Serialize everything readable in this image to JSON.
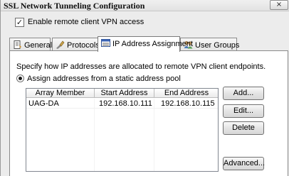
{
  "window": {
    "title": "SSL Network Tunneling Configuration",
    "close_glyph": "×"
  },
  "enable_vpn": {
    "label": "Enable remote client VPN access",
    "checked": true,
    "check_glyph": "✓"
  },
  "tabs": [
    {
      "label": "General",
      "icon": "general-page-icon",
      "active": false
    },
    {
      "label": "Protocols",
      "icon": "protocols-icon",
      "active": false
    },
    {
      "label": "IP Address Assignment",
      "icon": "ip-address-icon",
      "active": true
    },
    {
      "label": "User Groups",
      "icon": "user-groups-icon",
      "active": false
    }
  ],
  "ip_assignment": {
    "description": "Specify how IP addresses are allocated to remote VPN client endpoints.",
    "radio_label": "Assign addresses from a static address pool",
    "radio_selected": true,
    "table": {
      "columns": [
        "Array Member",
        "Start Address",
        "End Address"
      ],
      "rows": [
        {
          "array_member": "UAG-DA",
          "start_address": "192.168.10.111",
          "end_address": "192.168.10.115"
        }
      ]
    },
    "buttons": {
      "add": "Add...",
      "edit": "Edit...",
      "delete": "Delete",
      "advanced": "Advanced..."
    }
  },
  "colors": {
    "titlebar": "#e6e6e6",
    "panel": "#ffffff",
    "dialog_bg": "#ececec"
  }
}
